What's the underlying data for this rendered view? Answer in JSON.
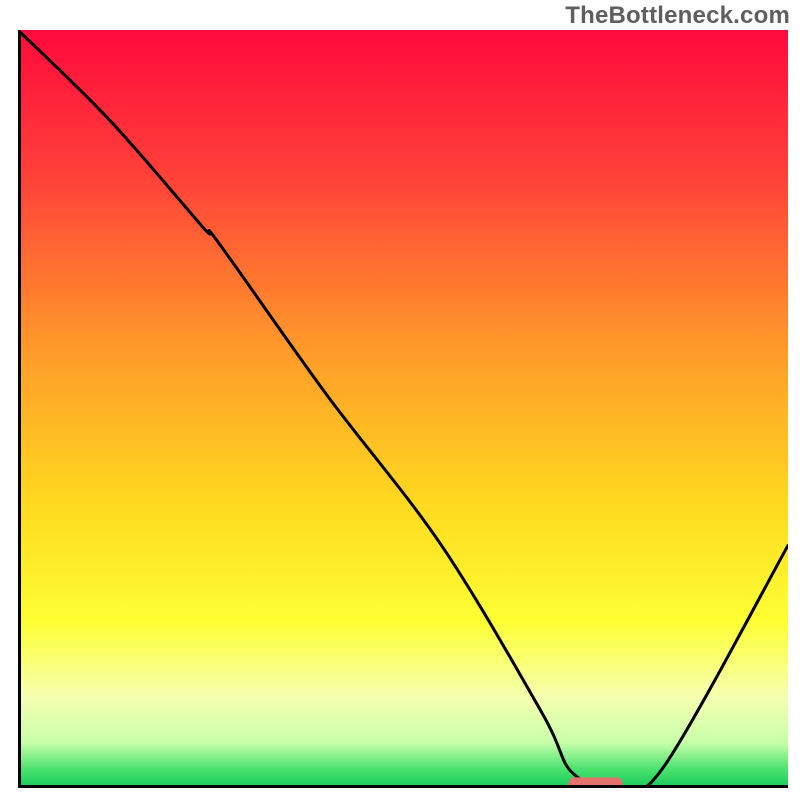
{
  "watermark": "TheBottleneck.com",
  "chart_data": {
    "type": "line",
    "title": "",
    "xlabel": "",
    "ylabel": "",
    "xlim": [
      0,
      100
    ],
    "ylim": [
      0,
      100
    ],
    "gradient_stops": [
      {
        "offset": 0.0,
        "color": "#ff0a3c"
      },
      {
        "offset": 0.2,
        "color": "#ff4338"
      },
      {
        "offset": 0.42,
        "color": "#ff9a2a"
      },
      {
        "offset": 0.62,
        "color": "#ffd81f"
      },
      {
        "offset": 0.78,
        "color": "#feff33"
      },
      {
        "offset": 0.88,
        "color": "#f6ffb0"
      },
      {
        "offset": 0.94,
        "color": "#c8ffa9"
      },
      {
        "offset": 0.975,
        "color": "#4be36f"
      },
      {
        "offset": 1.0,
        "color": "#14c95a"
      }
    ],
    "series": [
      {
        "name": "bottleneck-curve",
        "x": [
          0,
          12,
          24,
          26,
          40,
          55,
          68,
          72,
          78,
          84,
          100
        ],
        "y": [
          100,
          88,
          74,
          72,
          52,
          32,
          10,
          2,
          0,
          3,
          32
        ]
      }
    ],
    "marker": {
      "name": "optimal-range",
      "shape": "pill",
      "color": "#e2726b",
      "x_center": 75,
      "y": 0.6,
      "width": 7,
      "height": 1.6
    }
  }
}
